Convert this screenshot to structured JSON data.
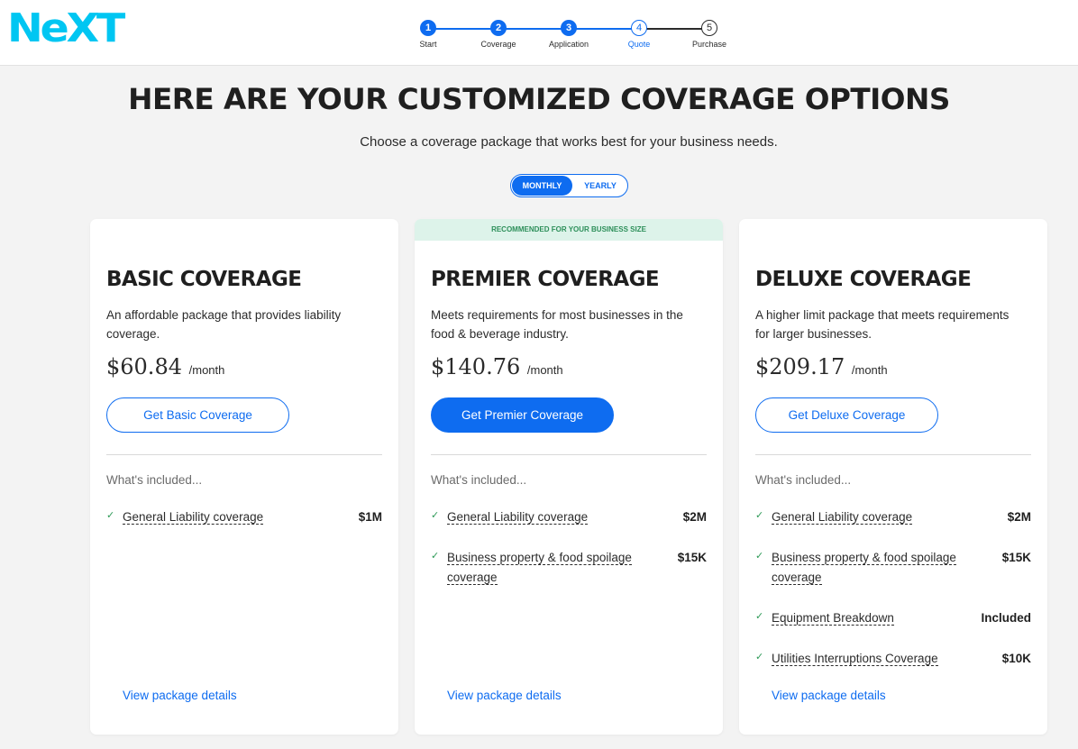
{
  "brand": {
    "logo_text": "NeXT",
    "logo_color": "#00c6f2"
  },
  "stepper": {
    "steps": [
      {
        "num": "1",
        "label": "Start",
        "state": "done"
      },
      {
        "num": "2",
        "label": "Coverage",
        "state": "done"
      },
      {
        "num": "3",
        "label": "Application",
        "state": "done"
      },
      {
        "num": "4",
        "label": "Quote",
        "state": "current"
      },
      {
        "num": "5",
        "label": "Purchase",
        "state": "todo"
      }
    ]
  },
  "headline": "HERE ARE YOUR CUSTOMIZED COVERAGE OPTIONS",
  "subhead": "Choose a coverage package that works best for your business needs.",
  "billing_toggle": {
    "monthly": "MONTHLY",
    "yearly": "YEARLY",
    "selected": "monthly"
  },
  "colors": {
    "accent": "#0e6cf0",
    "recommended_bg": "#ddf3ea",
    "recommended_text": "#2d8f5a",
    "check": "#2d9a57"
  },
  "included_label": "What's included...",
  "plans": [
    {
      "banner": "",
      "title": "BASIC COVERAGE",
      "description": "An affordable package that provides liability coverage.",
      "price": "$60.84",
      "period": "/month",
      "cta": "Get Basic Coverage",
      "cta_style": "outline",
      "items": [
        {
          "name": "General Liability coverage",
          "value": "$1M"
        }
      ],
      "details_link": "View package details"
    },
    {
      "banner": "RECOMMENDED FOR YOUR BUSINESS SIZE",
      "title": "PREMIER COVERAGE",
      "description": "Meets requirements for most businesses in the food & beverage industry.",
      "price": "$140.76",
      "period": "/month",
      "cta": "Get Premier Coverage",
      "cta_style": "filled",
      "items": [
        {
          "name": "General Liability coverage",
          "value": "$2M"
        },
        {
          "name": "Business property & food spoilage coverage",
          "value": "$15K"
        }
      ],
      "details_link": "View package details"
    },
    {
      "banner": "",
      "title": "DELUXE COVERAGE",
      "description": "A higher limit package that meets requirements for larger businesses.",
      "price": "$209.17",
      "period": "/month",
      "cta": "Get Deluxe Coverage",
      "cta_style": "outline",
      "items": [
        {
          "name": "General Liability coverage",
          "value": "$2M"
        },
        {
          "name": "Business property & food spoilage coverage",
          "value": "$15K"
        },
        {
          "name": "Equipment Breakdown",
          "value": "Included"
        },
        {
          "name": "Utilities Interruptions Coverage",
          "value": "$10K"
        }
      ],
      "details_link": "View package details"
    }
  ]
}
